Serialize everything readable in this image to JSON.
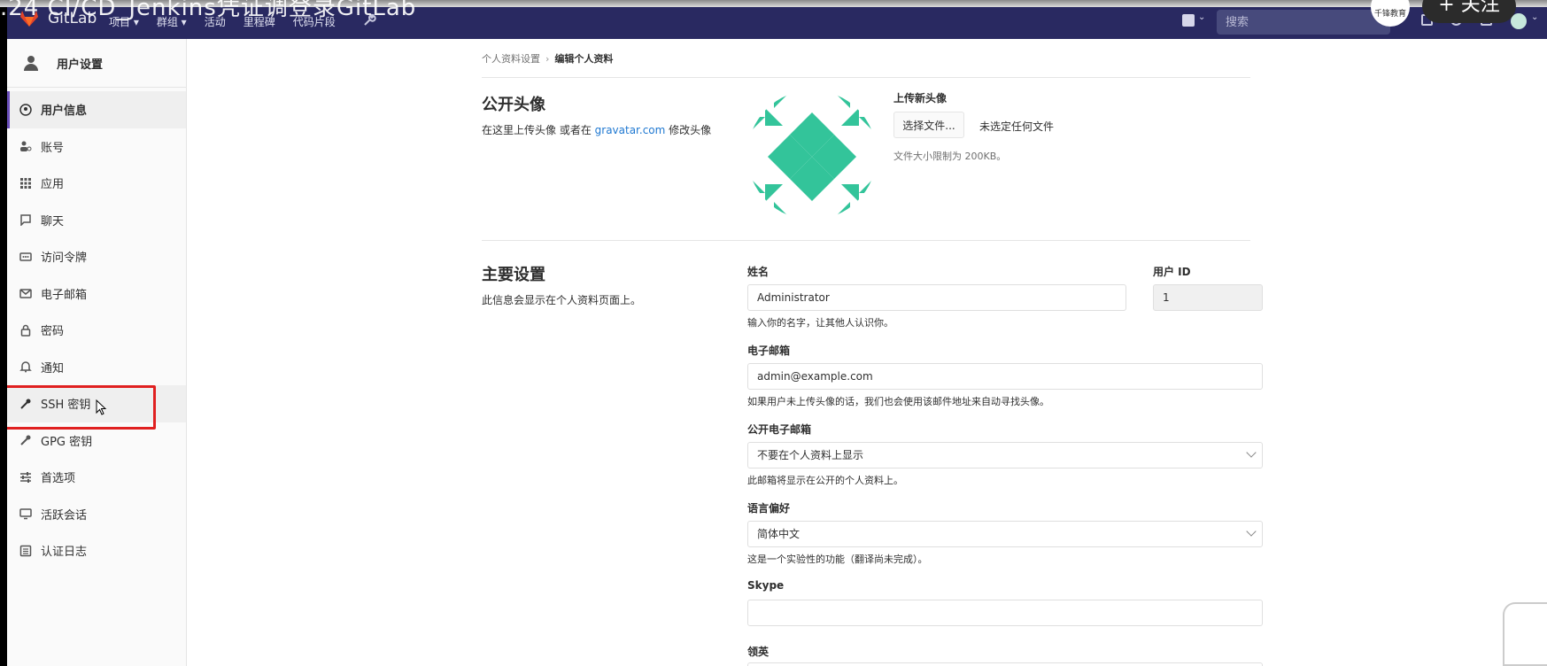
{
  "overlay": {
    "video_title": ".24 CI/CD_Jenkins凭证调登录GitLab",
    "badge_text": "千锋教育",
    "follow_label": "+ 关注"
  },
  "navbar": {
    "brand": "GitLab",
    "menu": [
      "项目 ▾",
      "群组 ▾",
      "活动",
      "里程碑",
      "代码片段"
    ],
    "search_placeholder": "搜索"
  },
  "sidebar": {
    "header": "用户设置",
    "items": [
      {
        "label": "用户信息",
        "icon": "user-circle-icon",
        "active": true
      },
      {
        "label": "账号",
        "icon": "account-gear-icon"
      },
      {
        "label": "应用",
        "icon": "grid-icon"
      },
      {
        "label": "聊天",
        "icon": "chat-icon"
      },
      {
        "label": "访问令牌",
        "icon": "token-icon"
      },
      {
        "label": "电子邮箱",
        "icon": "mail-icon"
      },
      {
        "label": "密码",
        "icon": "lock-icon"
      },
      {
        "label": "通知",
        "icon": "bell-icon"
      },
      {
        "label": "SSH 密钥",
        "icon": "key-icon",
        "highlighted": true
      },
      {
        "label": "GPG 密钥",
        "icon": "key-icon"
      },
      {
        "label": "首选项",
        "icon": "sliders-icon"
      },
      {
        "label": "活跃会话",
        "icon": "monitor-icon"
      },
      {
        "label": "认证日志",
        "icon": "list-icon"
      }
    ]
  },
  "breadcrumb": {
    "parent": "个人资料设置",
    "current": "编辑个人资料"
  },
  "avatar_section": {
    "title": "公开头像",
    "desc_prefix": "在这里上传头像 或者在 ",
    "desc_link": "gravatar.com",
    "desc_suffix": " 修改头像",
    "upload_label": "上传新头像",
    "choose_button": "选择文件...",
    "no_file": "未选定任何文件",
    "size_hint": "文件大小限制为 200KB。",
    "avatar_color": "#33c49a"
  },
  "main_settings": {
    "title": "主要设置",
    "desc": "此信息会显示在个人资料页面上。",
    "name": {
      "label": "姓名",
      "value": "Administrator",
      "help": "输入你的名字，让其他人认识你。"
    },
    "user_id": {
      "label": "用户 ID",
      "value": "1"
    },
    "email": {
      "label": "电子邮箱",
      "value": "admin@example.com",
      "help": "如果用户未上传头像的话，我们也会使用该邮件地址来自动寻找头像。"
    },
    "public_email": {
      "label": "公开电子邮箱",
      "value": "不要在个人资料上显示",
      "help": "此邮箱将显示在公开的个人资料上。"
    },
    "language": {
      "label": "语言偏好",
      "value": "简体中文",
      "help": "这是一个实验性的功能（翻译尚未完成）。"
    },
    "skype": {
      "label": "Skype",
      "value": ""
    },
    "linkedin": {
      "label": "领英"
    }
  },
  "colors": {
    "navbar": "#292961",
    "accent": "#6b4fbb",
    "link": "#1f78d1",
    "highlight": "#e02020"
  }
}
